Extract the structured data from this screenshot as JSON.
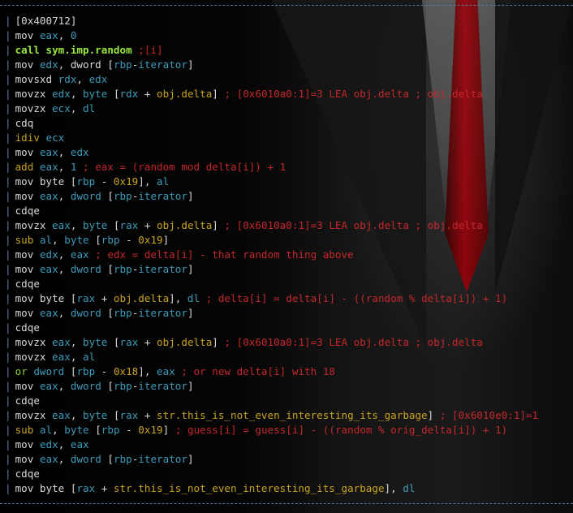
{
  "palette": {
    "w": "#d8d8d8",
    "c": "#3d9ab8",
    "y": "#c8a31e",
    "g": "#8bd23a",
    "gb": "#9be83f",
    "r": "#c4282c",
    "frame": "#5a78a0"
  },
  "lines": [
    [
      [
        "w",
        "[0x400712]"
      ]
    ],
    [
      [
        "w",
        "mov "
      ],
      [
        "c",
        "eax"
      ],
      [
        "w",
        ", "
      ],
      [
        "c",
        "0"
      ]
    ],
    [
      [
        "gb",
        "call sym.imp.random "
      ],
      [
        "r",
        ";[i]"
      ]
    ],
    [
      [
        "w",
        "mov "
      ],
      [
        "c",
        "edx"
      ],
      [
        "w",
        ", dword ["
      ],
      [
        "c",
        "rbp"
      ],
      [
        "w",
        "-"
      ],
      [
        "c",
        "iterator"
      ],
      [
        "w",
        "]"
      ]
    ],
    [
      [
        "w",
        "movsxd "
      ],
      [
        "c",
        "rdx"
      ],
      [
        "w",
        ", "
      ],
      [
        "c",
        "edx"
      ]
    ],
    [
      [
        "w",
        "movzx "
      ],
      [
        "c",
        "edx"
      ],
      [
        "w",
        ", "
      ],
      [
        "c",
        "byte"
      ],
      [
        "w",
        " ["
      ],
      [
        "c",
        "rdx"
      ],
      [
        "w",
        " + "
      ],
      [
        "y",
        "obj.delta"
      ],
      [
        "w",
        "] "
      ],
      [
        "r",
        "; [0x6010a0:1]=3 LEA obj.delta ; obj.delta"
      ]
    ],
    [
      [
        "w",
        "movzx "
      ],
      [
        "c",
        "ecx"
      ],
      [
        "w",
        ", "
      ],
      [
        "c",
        "dl"
      ]
    ],
    [
      [
        "w",
        "cdq"
      ]
    ],
    [
      [
        "y",
        "idiv "
      ],
      [
        "c",
        "ecx"
      ]
    ],
    [
      [
        "w",
        "mov "
      ],
      [
        "c",
        "eax"
      ],
      [
        "w",
        ", "
      ],
      [
        "c",
        "edx"
      ]
    ],
    [
      [
        "y",
        "add "
      ],
      [
        "c",
        "eax"
      ],
      [
        "w",
        ", "
      ],
      [
        "c",
        "1"
      ],
      [
        "r",
        " ; eax = (random mod delta[i]) + 1"
      ]
    ],
    [
      [
        "w",
        "mov byte ["
      ],
      [
        "c",
        "rbp"
      ],
      [
        "w",
        " - "
      ],
      [
        "y",
        "0x19"
      ],
      [
        "w",
        "], "
      ],
      [
        "c",
        "al"
      ]
    ],
    [
      [
        "w",
        "mov "
      ],
      [
        "c",
        "eax"
      ],
      [
        "w",
        ", "
      ],
      [
        "c",
        "dword"
      ],
      [
        "w",
        " ["
      ],
      [
        "c",
        "rbp"
      ],
      [
        "w",
        "-"
      ],
      [
        "c",
        "iterator"
      ],
      [
        "w",
        "]"
      ]
    ],
    [
      [
        "w",
        "cdqe"
      ]
    ],
    [
      [
        "w",
        "movzx "
      ],
      [
        "c",
        "eax"
      ],
      [
        "w",
        ", "
      ],
      [
        "c",
        "byte"
      ],
      [
        "w",
        " ["
      ],
      [
        "c",
        "rax"
      ],
      [
        "w",
        " + "
      ],
      [
        "y",
        "obj.delta"
      ],
      [
        "w",
        "] "
      ],
      [
        "r",
        "; [0x6010a0:1]=3 LEA obj.delta ; obj.delta"
      ]
    ],
    [
      [
        "y",
        "sub "
      ],
      [
        "c",
        "al"
      ],
      [
        "w",
        ", "
      ],
      [
        "c",
        "byte"
      ],
      [
        "w",
        " ["
      ],
      [
        "c",
        "rbp"
      ],
      [
        "w",
        " - "
      ],
      [
        "y",
        "0x19"
      ],
      [
        "w",
        "]"
      ]
    ],
    [
      [
        "w",
        "mov "
      ],
      [
        "c",
        "edx"
      ],
      [
        "w",
        ", "
      ],
      [
        "c",
        "eax"
      ],
      [
        "r",
        " ; edx = delta[i] - that random thing above"
      ]
    ],
    [
      [
        "w",
        "mov "
      ],
      [
        "c",
        "eax"
      ],
      [
        "w",
        ", "
      ],
      [
        "c",
        "dword"
      ],
      [
        "w",
        " ["
      ],
      [
        "c",
        "rbp"
      ],
      [
        "w",
        "-"
      ],
      [
        "c",
        "iterator"
      ],
      [
        "w",
        "]"
      ]
    ],
    [
      [
        "w",
        "cdqe"
      ]
    ],
    [
      [
        "w",
        "mov byte ["
      ],
      [
        "c",
        "rax"
      ],
      [
        "w",
        " + "
      ],
      [
        "y",
        "obj.delta"
      ],
      [
        "w",
        "], "
      ],
      [
        "c",
        "dl"
      ],
      [
        "r",
        " ; delta[i] = delta[i] - ((random % delta[i]) + 1)"
      ]
    ],
    [
      [
        "w",
        "mov "
      ],
      [
        "c",
        "eax"
      ],
      [
        "w",
        ", "
      ],
      [
        "c",
        "dword"
      ],
      [
        "w",
        " ["
      ],
      [
        "c",
        "rbp"
      ],
      [
        "w",
        "-"
      ],
      [
        "c",
        "iterator"
      ],
      [
        "w",
        "]"
      ]
    ],
    [
      [
        "w",
        "cdqe"
      ]
    ],
    [
      [
        "w",
        "movzx "
      ],
      [
        "c",
        "eax"
      ],
      [
        "w",
        ", "
      ],
      [
        "c",
        "byte"
      ],
      [
        "w",
        " ["
      ],
      [
        "c",
        "rax"
      ],
      [
        "w",
        " + "
      ],
      [
        "y",
        "obj.delta"
      ],
      [
        "w",
        "] "
      ],
      [
        "r",
        "; [0x6010a0:1]=3 LEA obj.delta ; obj.delta"
      ]
    ],
    [
      [
        "w",
        "movzx "
      ],
      [
        "c",
        "eax"
      ],
      [
        "w",
        ", "
      ],
      [
        "c",
        "al"
      ]
    ],
    [
      [
        "g",
        "or "
      ],
      [
        "c",
        "dword"
      ],
      [
        "w",
        " ["
      ],
      [
        "c",
        "rbp"
      ],
      [
        "w",
        " - "
      ],
      [
        "y",
        "0x18"
      ],
      [
        "w",
        "], "
      ],
      [
        "c",
        "eax"
      ],
      [
        "r",
        " ; or new delta[i] with 18"
      ]
    ],
    [
      [
        "w",
        "mov "
      ],
      [
        "c",
        "eax"
      ],
      [
        "w",
        ", "
      ],
      [
        "c",
        "dword"
      ],
      [
        "w",
        " ["
      ],
      [
        "c",
        "rbp"
      ],
      [
        "w",
        "-"
      ],
      [
        "c",
        "iterator"
      ],
      [
        "w",
        "]"
      ]
    ],
    [
      [
        "w",
        "cdqe"
      ]
    ],
    [
      [
        "w",
        "movzx "
      ],
      [
        "c",
        "eax"
      ],
      [
        "w",
        ", "
      ],
      [
        "c",
        "byte"
      ],
      [
        "w",
        " ["
      ],
      [
        "c",
        "rax"
      ],
      [
        "w",
        " + "
      ],
      [
        "y",
        "str.this_is_not_even_interesting_its_garbage"
      ],
      [
        "w",
        "] "
      ],
      [
        "r",
        "; [0x6010e0:1]=1"
      ]
    ],
    [
      [
        "y",
        "sub "
      ],
      [
        "c",
        "al"
      ],
      [
        "w",
        ", "
      ],
      [
        "c",
        "byte"
      ],
      [
        "w",
        " ["
      ],
      [
        "c",
        "rbp"
      ],
      [
        "w",
        " - "
      ],
      [
        "y",
        "0x19"
      ],
      [
        "w",
        "]"
      ],
      [
        "r",
        " ; guess[i] = guess[i] - ((random % orig_delta[i]) + 1)"
      ]
    ],
    [
      [
        "w",
        "mov "
      ],
      [
        "c",
        "edx"
      ],
      [
        "w",
        ", "
      ],
      [
        "c",
        "eax"
      ]
    ],
    [
      [
        "w",
        "mov "
      ],
      [
        "c",
        "eax"
      ],
      [
        "w",
        ", "
      ],
      [
        "c",
        "dword"
      ],
      [
        "w",
        " ["
      ],
      [
        "c",
        "rbp"
      ],
      [
        "w",
        "-"
      ],
      [
        "c",
        "iterator"
      ],
      [
        "w",
        "]"
      ]
    ],
    [
      [
        "w",
        "cdqe"
      ]
    ],
    [
      [
        "w",
        "mov byte ["
      ],
      [
        "c",
        "rax"
      ],
      [
        "w",
        " + "
      ],
      [
        "y",
        "str.this_is_not_even_interesting_its_garbage"
      ],
      [
        "w",
        "], "
      ],
      [
        "c",
        "dl"
      ]
    ]
  ]
}
